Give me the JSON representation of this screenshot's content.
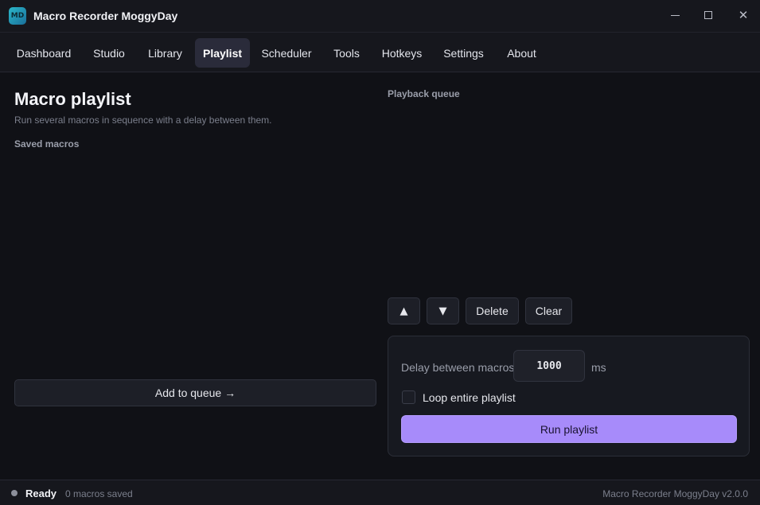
{
  "window": {
    "title": "Macro Recorder MoggyDay",
    "logo_text": "MD",
    "minimize_icon": "minimize-icon",
    "maximize_icon": "maximize-icon",
    "close_icon": "close-icon"
  },
  "nav": {
    "tabs": [
      {
        "label": "Dashboard",
        "active": false
      },
      {
        "label": "Studio",
        "active": false
      },
      {
        "label": "Library",
        "active": false
      },
      {
        "label": "Playlist",
        "active": true
      },
      {
        "label": "Scheduler",
        "active": false
      },
      {
        "label": "Tools",
        "active": false
      },
      {
        "label": "Hotkeys",
        "active": false
      },
      {
        "label": "Settings",
        "active": false
      },
      {
        "label": "About",
        "active": false
      }
    ]
  },
  "page": {
    "title": "Macro playlist",
    "subtitle": "Run several macros in sequence with a delay between them.",
    "saved_label": "Saved macros",
    "saved_items": [],
    "add_to_queue_label": "Add to queue →"
  },
  "queue": {
    "label": "Playback queue",
    "items": [],
    "up_label": "▲",
    "down_label": "▼",
    "delete_label": "Delete",
    "clear_label": "Clear"
  },
  "options": {
    "delay_label": "Delay between macros",
    "delay_value": "1000",
    "delay_unit": "ms",
    "loop_label": "Loop entire playlist",
    "loop_checked": false,
    "run_label": "Run playlist"
  },
  "status": {
    "state": "Ready",
    "count": "0 macros saved",
    "version": "Macro Recorder MoggyDay v2.0.0"
  },
  "colors": {
    "background": "#101116",
    "bar": "#16171d",
    "accent": "#a78bfa",
    "active_tab": "#2a2b3a"
  }
}
